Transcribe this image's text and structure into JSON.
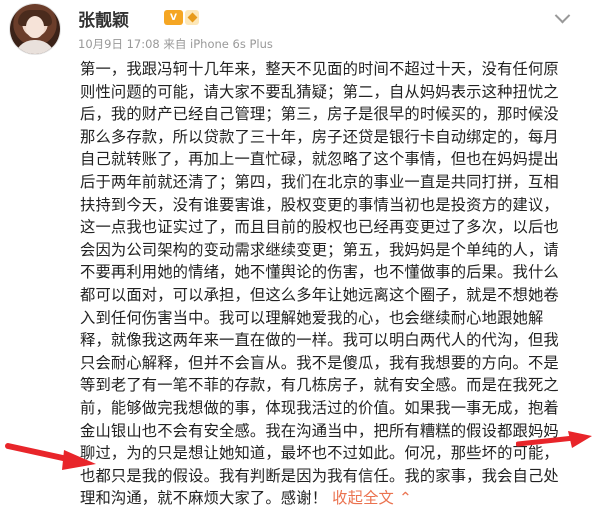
{
  "user": {
    "name": "张靓颖",
    "badge_text": "V"
  },
  "post": {
    "meta": "10月9日 17:08 来自 iPhone 6s Plus",
    "text_main": "第一，我跟冯轲十几年来，整天不见面的时间不超过十天，没有任何原则性问题的可能，请大家不要乱猜疑；第二，自从妈妈表示这种扭忧之后，我的财产已经自己管理；第三，房子是很早的时候买的，那时候没那么多存款，所以贷款了三十年，房子还贷是银行卡自动绑定的，每月自己就转账了，再加上一直忙碌，就忽略了这个事情，但也在妈妈提出后于两年前就还清了；第四，我们在北京的事业一直是共同打拼，互相扶持到今天，没有谁要害谁，股权变更的事情当初也是投资方的建议，这一点我也证实过了，而且目前的股权也已经再变更过了多次，以后也会因为公司架构的变动需求继续变更；第五，我妈妈是个单纯的人，请不要再利用她的情绪，她不懂舆论的伤害，也不懂做事的后果。我什么都可以面对，可以承担，但这么多年让她远离这个圈子，就是不想她卷入到任何伤害当中。我可以理解她爱我的心，也会继续耐心地跟她解释，就像我这两年来一直在做的一样。我可以明白两代人的代沟，但我只会耐心解释，但并不会盲从。我不是傻瓜，我有我想要的方向。不是等到老了有一笔不菲的存款，有几栋房子，就有安全感。而是在我死之前，能够做完我想做的事，体现我活过的价值。如果我一事无成，抱着金山银山也不会有安全感。我在沟通当中，把所有糟糕的假设都跟妈妈聊过，为的只是想让她知道，最坏也不过如此。何况，那些坏的可能，也都只是我的假设。我有判断是因为我有信任。我的家事，我会自己处理和沟通，就不麻烦大家了。感谢！",
    "collapse_link": "收起全文",
    "collapse_caret": "⌃"
  },
  "colors": {
    "accent_link": "#eb7350",
    "annotation_red": "#e8252a",
    "vip_orange": "#f5a623"
  },
  "icons": {
    "menu": "chevron-down-icon",
    "vip": "vip-badge-icon",
    "avatar": "avatar"
  }
}
